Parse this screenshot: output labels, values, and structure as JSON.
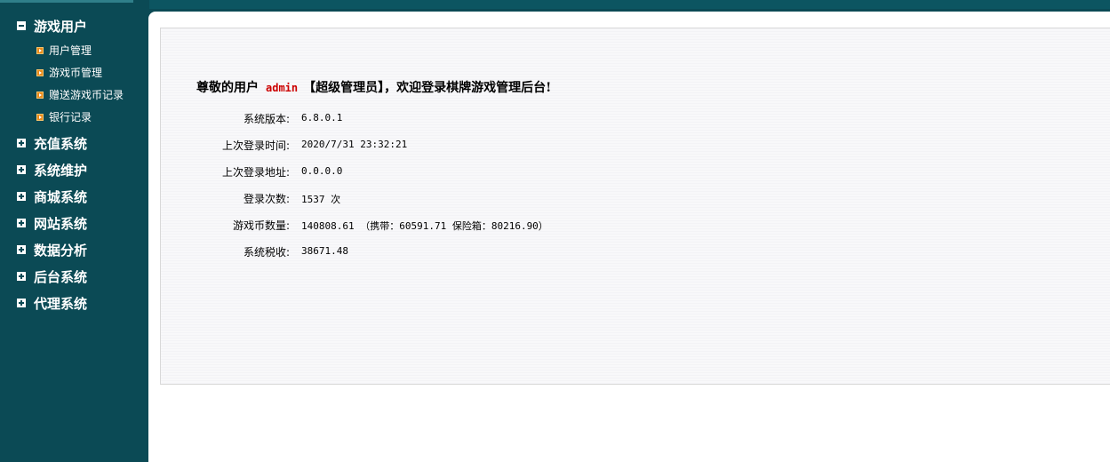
{
  "sidebar": {
    "groups": [
      {
        "label": "游戏用户",
        "expanded": true,
        "items": [
          {
            "label": "用户管理"
          },
          {
            "label": "游戏币管理"
          },
          {
            "label": "赠送游戏币记录"
          },
          {
            "label": "银行记录"
          }
        ]
      },
      {
        "label": "充值系统",
        "expanded": false
      },
      {
        "label": "系统维护",
        "expanded": false
      },
      {
        "label": "商城系统",
        "expanded": false
      },
      {
        "label": "网站系统",
        "expanded": false
      },
      {
        "label": "数据分析",
        "expanded": false
      },
      {
        "label": "后台系统",
        "expanded": false
      },
      {
        "label": "代理系统",
        "expanded": false
      }
    ]
  },
  "welcome": {
    "prefix": "尊敬的用户",
    "username": "admin",
    "suffix": "【超级管理员】，欢迎登录棋牌游戏管理后台!"
  },
  "info": [
    {
      "label": "系统版本:",
      "value": "6.8.0.1"
    },
    {
      "label": "上次登录时间:",
      "value": "2020/7/31 23:32:21"
    },
    {
      "label": "上次登录地址:",
      "value": "0.0.0.0"
    },
    {
      "label": "登录次数:",
      "value": "1537 次"
    },
    {
      "label": "游戏币数量:",
      "value": "140808.61 （携带：60591.71 保险箱：80216.90）"
    },
    {
      "label": "系统税收:",
      "value": "38671.48"
    }
  ],
  "colors": {
    "sidebar_bg": "#0b4a55",
    "username": "#cc0000",
    "bullet": "#e88a1a"
  }
}
